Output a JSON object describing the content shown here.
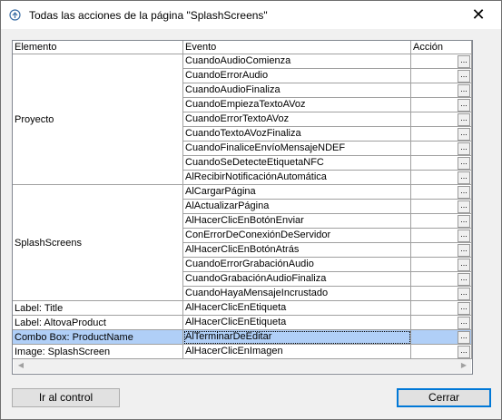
{
  "window": {
    "title": "Todas las acciones de la página \"SplashScreens\"",
    "close_glyph": "✕"
  },
  "grid": {
    "columns": [
      "Elemento",
      "Evento",
      "Acción"
    ],
    "groups": [
      {
        "element": "Proyecto",
        "events": [
          "CuandoAudioComienza",
          "CuandoErrorAudio",
          "CuandoAudioFinaliza",
          "CuandoEmpiezaTextoAVoz",
          "CuandoErrorTextoAVoz",
          "CuandoTextoAVozFinaliza",
          "CuandoFinaliceEnvíoMensajeNDEF",
          "CuandoSeDetecteEtiquetaNFC",
          "AlRecibirNotificaciónAutomática"
        ]
      },
      {
        "element": "SplashScreens",
        "events": [
          "AlCargarPágina",
          "AlActualizarPágina",
          "AlHacerClicEnBotónEnviar",
          "ConErrorDeConexiónDeServidor",
          "AlHacerClicEnBotónAtrás",
          "CuandoErrorGrabaciónAudio",
          "CuandoGrabaciónAudioFinaliza",
          "CuandoHayaMensajeIncrustado"
        ]
      },
      {
        "element": "Label: Title",
        "events": [
          "AlHacerClicEnEtiqueta"
        ]
      },
      {
        "element": "Label: AltovaProduct",
        "events": [
          "AlHacerClicEnEtiqueta"
        ]
      },
      {
        "element": "Combo Box: ProductName",
        "events": [
          "AlTerminarDeEditar"
        ],
        "selected": true
      },
      {
        "element": "Image: SplashScreen",
        "events": [
          "AlHacerClicEnImagen"
        ]
      }
    ],
    "action_button_label": "...",
    "scroll_left": "◀",
    "scroll_right": "▶"
  },
  "buttons": {
    "goto": "Ir al control",
    "close": "Cerrar"
  },
  "colors": {
    "selection": "#b0cff7",
    "default_button_border": "#0078d7"
  }
}
